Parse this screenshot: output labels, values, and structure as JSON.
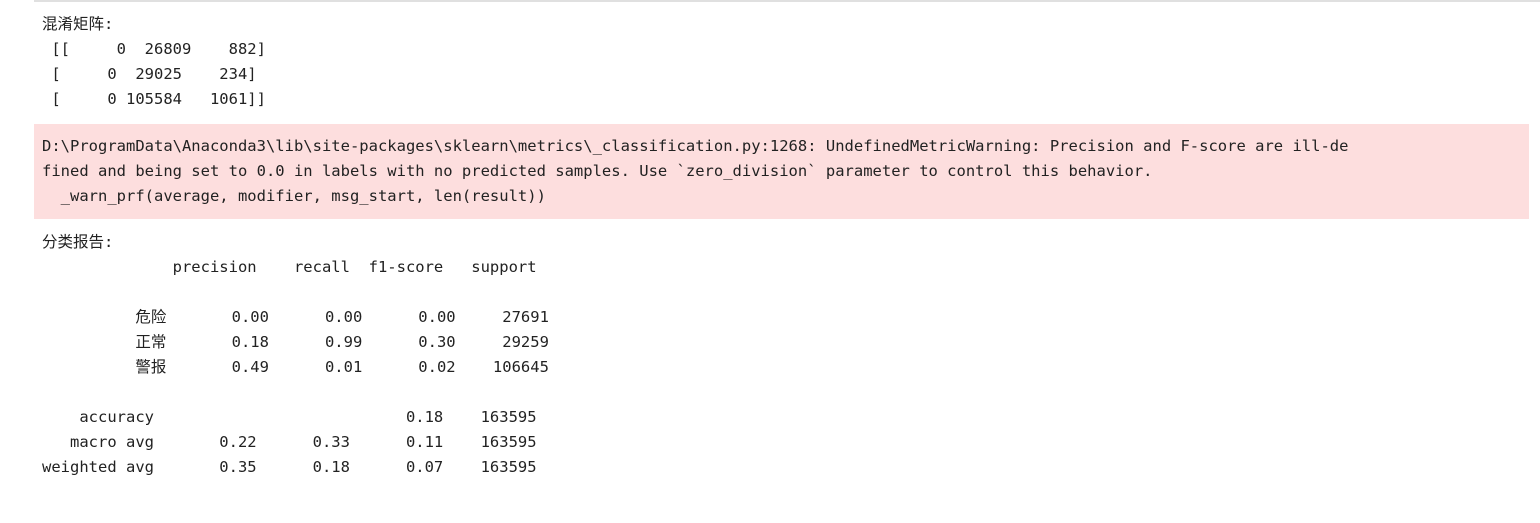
{
  "output_1": {
    "text": "混淆矩阵:\n [[     0  26809    882]\n [     0  29025    234]\n [     0 105584   1061]]"
  },
  "warning": {
    "text": "D:\\ProgramData\\Anaconda3\\lib\\site-packages\\sklearn\\metrics\\_classification.py:1268: UndefinedMetricWarning: Precision and F-score are ill-de\nfined and being set to 0.0 in labels with no predicted samples. Use `zero_division` parameter to control this behavior.\n  _warn_prf(average, modifier, msg_start, len(result))"
  },
  "output_2": {
    "text": "分类报告:\n              precision    recall  f1-score   support\n\n          危险       0.00      0.00      0.00     27691\n          正常       0.18      0.99      0.30     29259\n          警报       0.49      0.01      0.02    106645\n\n    accuracy                           0.18    163595\n   macro avg       0.22      0.33      0.11    163595\nweighted avg       0.35      0.18      0.07    163595"
  },
  "colors": {
    "stderr_background": "#fddede",
    "text": "#222222"
  }
}
